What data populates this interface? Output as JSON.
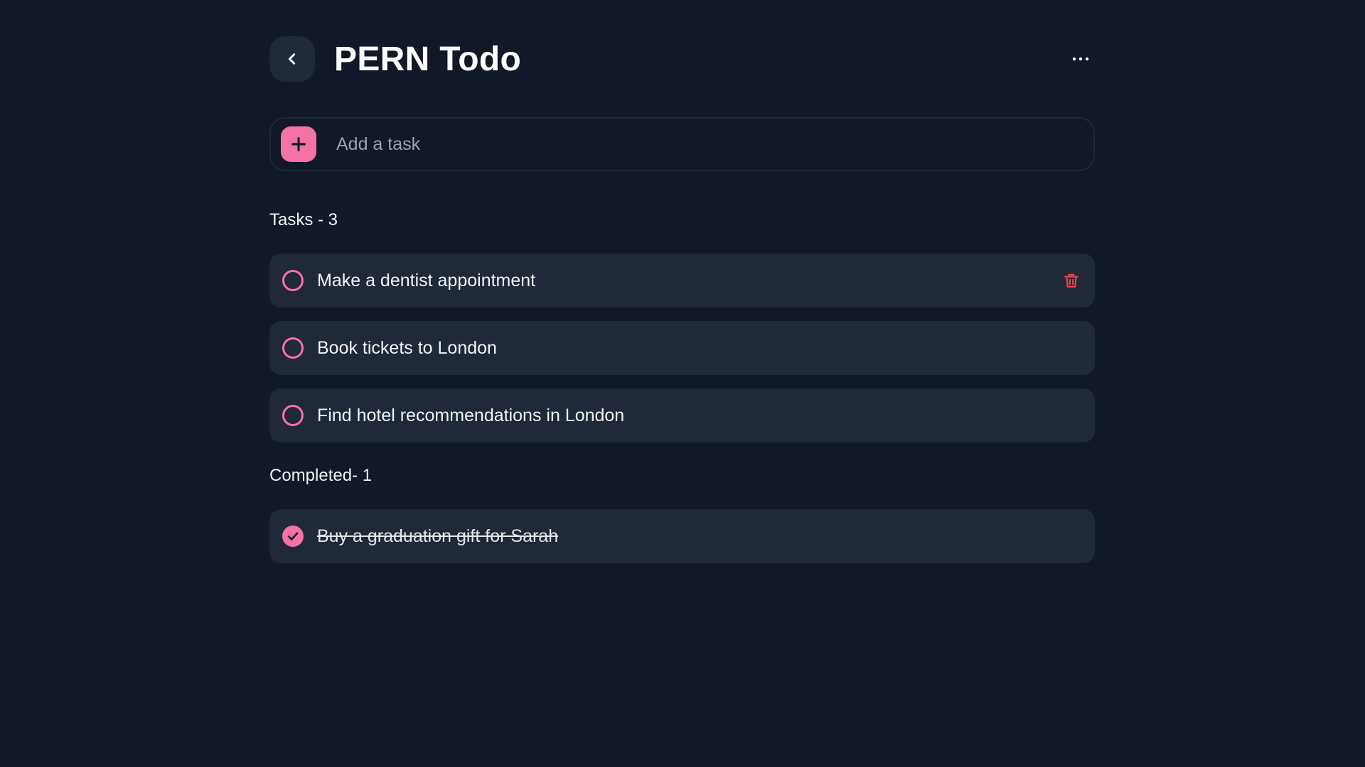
{
  "header": {
    "title": "PERN Todo"
  },
  "add_task": {
    "placeholder": "Add a task",
    "value": ""
  },
  "tasks_section": {
    "label": "Tasks - 3",
    "items": [
      {
        "text": "Make a dentist appointment",
        "completed": false
      },
      {
        "text": "Book tickets to London",
        "completed": false
      },
      {
        "text": "Find hotel recommendations in London",
        "completed": false
      }
    ]
  },
  "completed_section": {
    "label": "Completed- 1",
    "items": [
      {
        "text": "Buy a graduation gift for Sarah",
        "completed": true
      }
    ]
  },
  "icons": {
    "back": "chevron-left-icon",
    "more": "more-horizontal-icon",
    "add": "plus-icon",
    "delete": "trash-icon",
    "check": "check-icon"
  },
  "colors": {
    "background": "#111827",
    "card": "#1f2937",
    "accent": "#f472a6",
    "danger": "#ef4444",
    "placeholder": "#9ca3af"
  }
}
